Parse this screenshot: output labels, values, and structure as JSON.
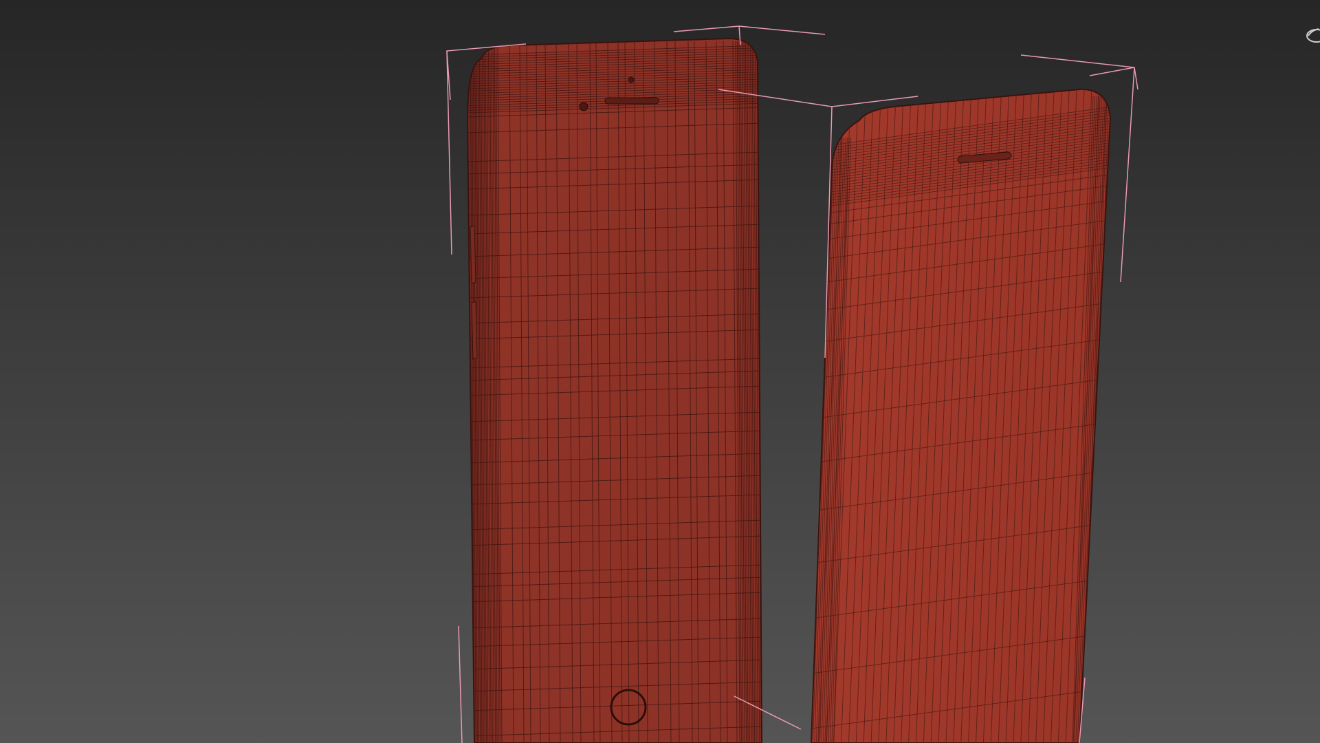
{
  "viewport": {
    "background_top": "#262626",
    "background_bottom": "#555555"
  },
  "objects": [
    {
      "name": "phone-front",
      "color": "#8f3327",
      "wire_color": "#3e1410"
    },
    {
      "name": "phone-screen-panel",
      "color": "#a53a2c",
      "wire_color": "#4a1a14"
    }
  ],
  "selection_bracket_color": "#e89ab4",
  "icons": {
    "viewcube": "orbit-gizmo-icon"
  }
}
